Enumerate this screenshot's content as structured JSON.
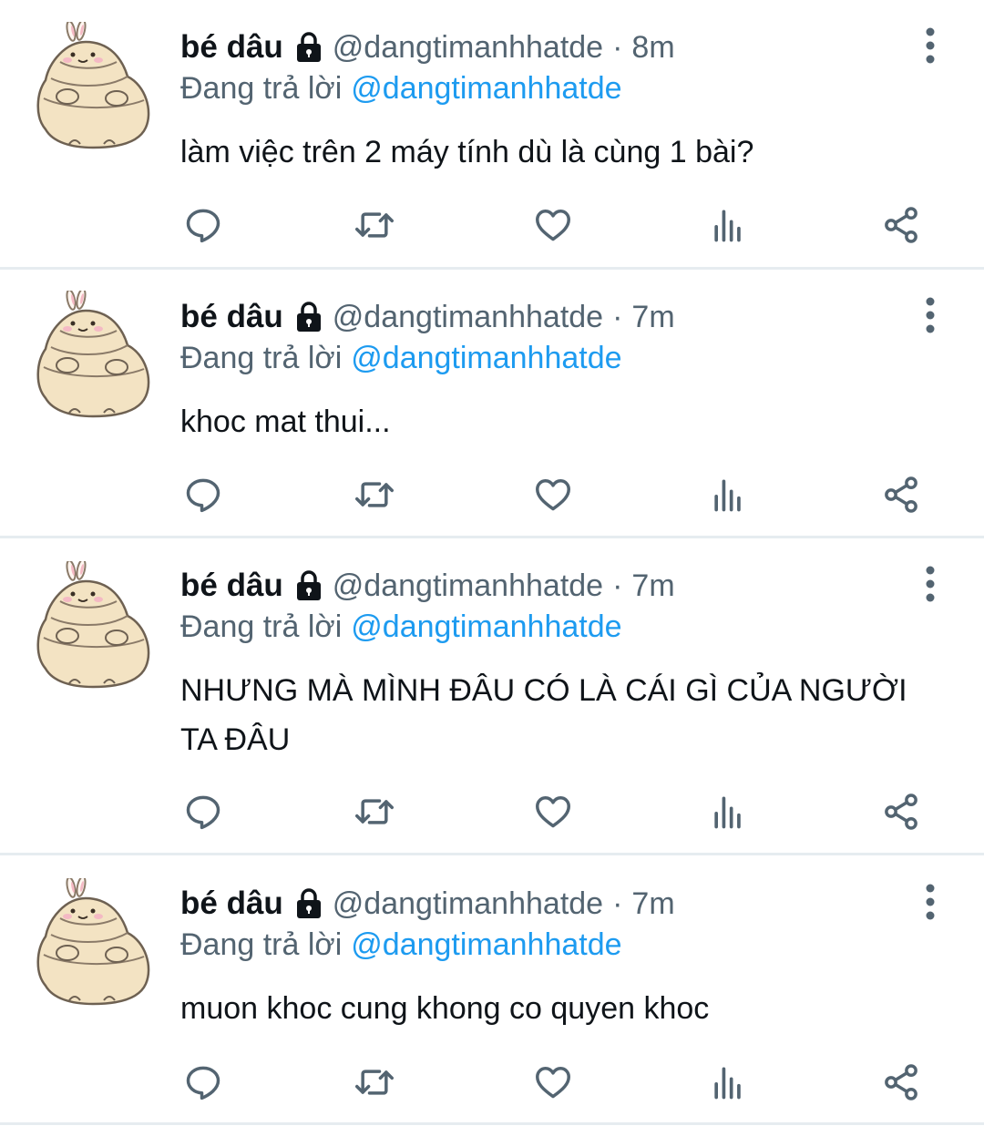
{
  "colors": {
    "text": "#0f1419",
    "secondary": "#536471",
    "mention": "#1d9bf0",
    "divider": "#e6ecf0"
  },
  "icons": {
    "lock": "lock-icon",
    "more": "more-vertical-icon",
    "reply": "reply-bubble-icon",
    "retweet": "retweet-icon",
    "like": "heart-icon",
    "views": "analytics-bars-icon",
    "share": "share-icon"
  },
  "tweets": [
    {
      "name": "bé dâu",
      "handle": "@dangtimanhhatde",
      "separator": "·",
      "time": "8m",
      "reply_prefix": "Đang trả lời",
      "reply_to": "@dangtimanhhatde",
      "text": "làm việc trên 2 máy tính dù là cùng 1 bài?"
    },
    {
      "name": "bé dâu",
      "handle": "@dangtimanhhatde",
      "separator": "·",
      "time": "7m",
      "reply_prefix": "Đang trả lời",
      "reply_to": "@dangtimanhhatde",
      "text": "khoc mat thui..."
    },
    {
      "name": "bé dâu",
      "handle": "@dangtimanhhatde",
      "separator": "·",
      "time": "7m",
      "reply_prefix": "Đang trả lời",
      "reply_to": "@dangtimanhhatde",
      "text": "NHƯNG MÀ MÌNH ĐÂU CÓ LÀ CÁI GÌ CỦA NGƯỜI TA ĐÂU"
    },
    {
      "name": "bé dâu",
      "handle": "@dangtimanhhatde",
      "separator": "·",
      "time": "7m",
      "reply_prefix": "Đang trả lời",
      "reply_to": "@dangtimanhhatde",
      "text": "muon khoc cung khong co quyen khoc"
    }
  ]
}
